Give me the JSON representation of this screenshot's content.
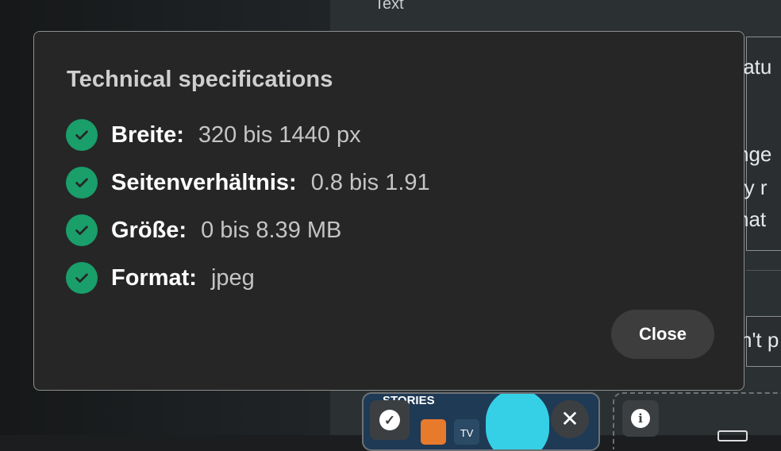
{
  "background": {
    "top_label": "Text",
    "right_card_lines": [
      "tatu",
      "nge",
      "ry r",
      "hat"
    ],
    "right_card2_text": "n't p",
    "thumbnail_label": "STORIES",
    "thumbnail_tv": "TV"
  },
  "dialog": {
    "title": "Technical specifications",
    "specs": [
      {
        "label": "Breite:",
        "value": "320 bis 1440 px"
      },
      {
        "label": "Seitenverhältnis:",
        "value": "0.8 bis 1.91"
      },
      {
        "label": "Größe:",
        "value": "0 bis 8.39 MB"
      },
      {
        "label": "Format:",
        "value": "jpeg"
      }
    ],
    "close_label": "Close"
  },
  "colors": {
    "dialog_bg": "#262626",
    "check_green": "#1a9e6a",
    "close_button_bg": "#3d3d3d"
  }
}
